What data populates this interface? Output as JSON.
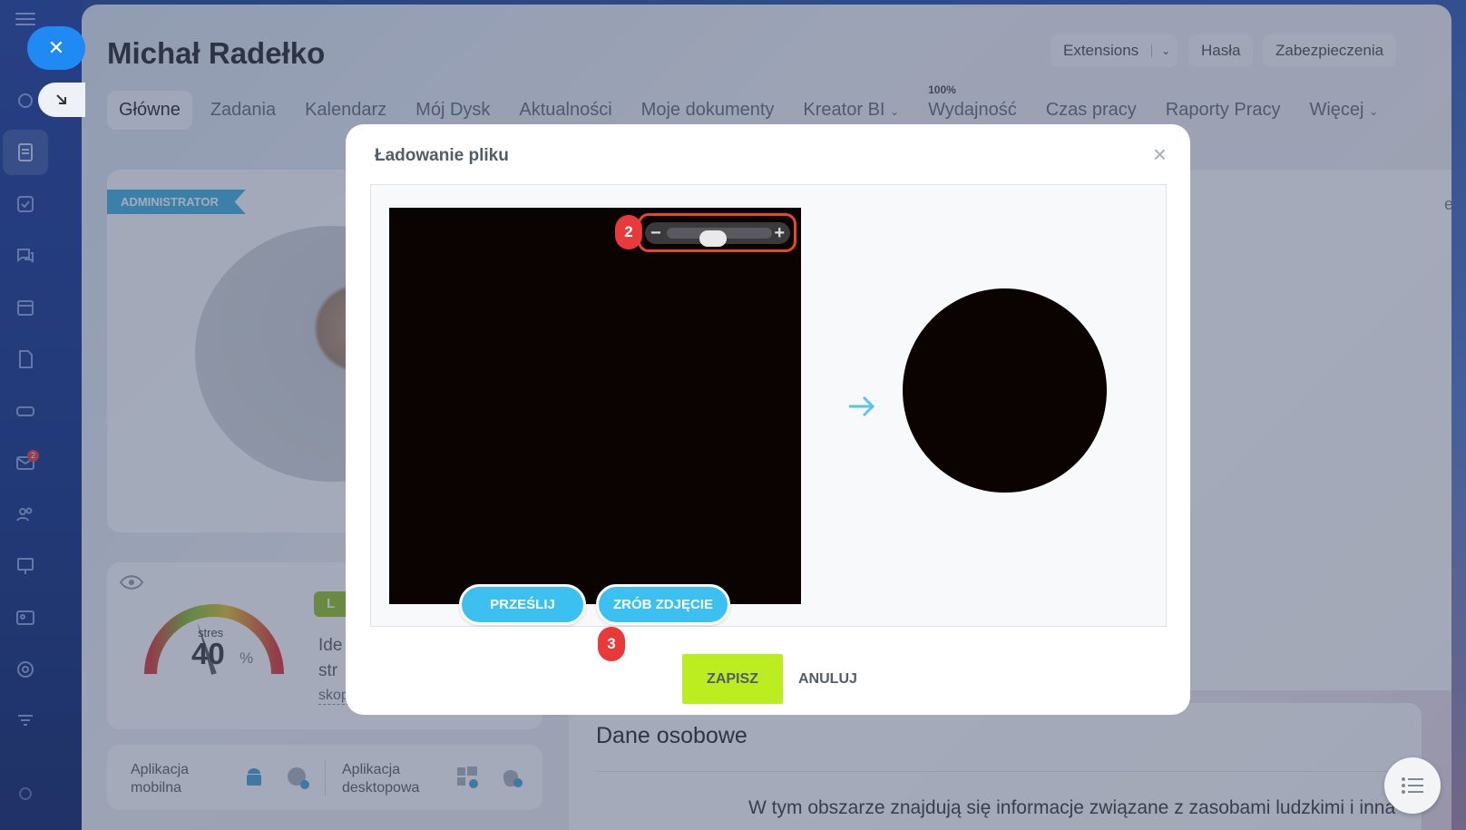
{
  "page": {
    "title": "Michał Radełko",
    "top_buttons": {
      "extensions": "Extensions",
      "passwords": "Hasła",
      "security": "Zabezpieczenia"
    },
    "tabs": [
      {
        "label": "Główne"
      },
      {
        "label": "Zadania"
      },
      {
        "label": "Kalendarz"
      },
      {
        "label": "Mój Dysk"
      },
      {
        "label": "Aktualności"
      },
      {
        "label": "Moje dokumenty"
      },
      {
        "label": "Kreator BI"
      },
      {
        "label": "Wydajność",
        "sup": "100%"
      },
      {
        "label": "Czas pracy"
      },
      {
        "label": "Raporty Pracy"
      },
      {
        "label": "Więcej"
      }
    ]
  },
  "sidebar": {
    "mail_badge": "2"
  },
  "profile": {
    "role_tag": "ADMINISTRATOR",
    "edit_link": "edytuj"
  },
  "stress": {
    "label": "stres",
    "value": "40",
    "unit": "%",
    "level": 0.4,
    "tag": "L",
    "text_line1": "Ide",
    "text_line2": "str",
    "link": "skop"
  },
  "apps": {
    "mobile_line1": "Aplikacja",
    "mobile_line2": "mobilna",
    "desktop_line1": "Aplikacja",
    "desktop_line2": "desktopowa"
  },
  "personal": {
    "title": "Dane osobowe",
    "text": "W tym obszarze znajdują się informacje związane z zasobami ludzkimi i inna"
  },
  "modal": {
    "title": "Ładowanie pliku",
    "zoom_level": 0.42,
    "step_zoom": "2",
    "step_capture": "3",
    "upload_label": "PRZEŚLIJ",
    "capture_label": "ZRÓB ZDJĘCIE",
    "save_label": "ZAPISZ",
    "cancel_label": "ANULUJ"
  },
  "colors": {
    "accent": "#3bc0ef",
    "save": "#bbed21",
    "highlight": "#e5492d",
    "badge": "#e83a3a",
    "sidebar": "#2747a2"
  }
}
